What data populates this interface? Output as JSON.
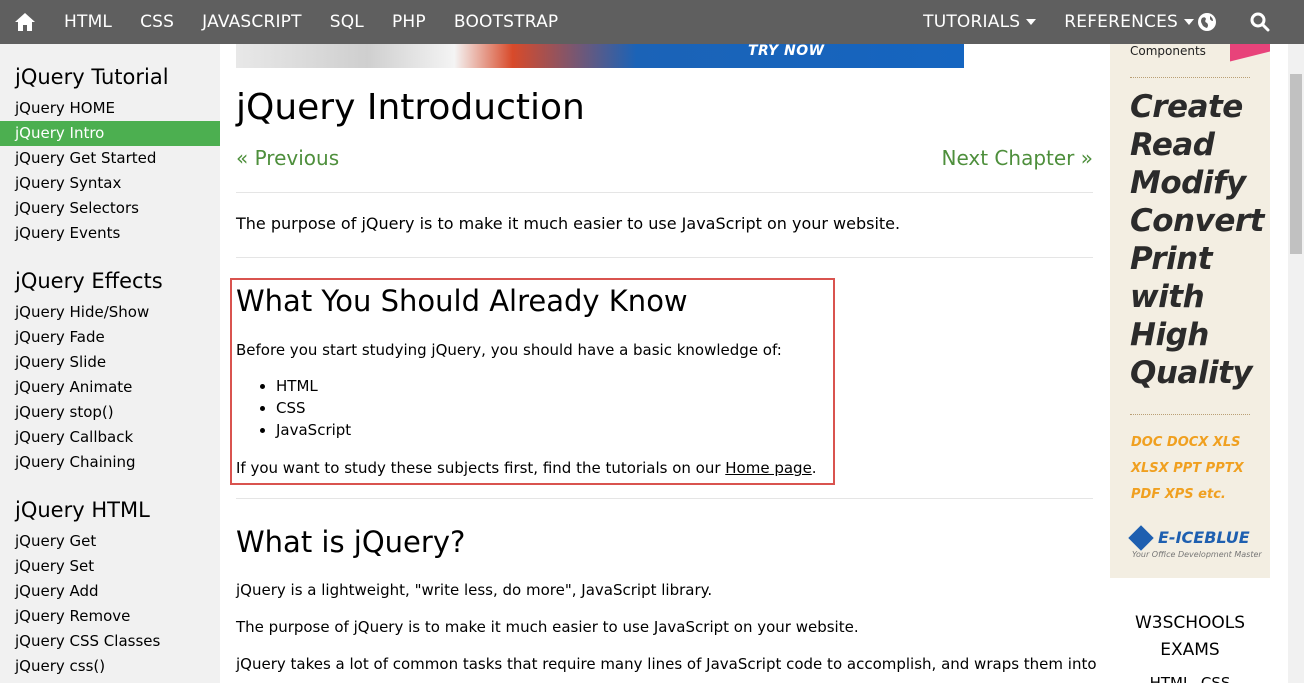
{
  "topnav": {
    "home_icon": "home-icon",
    "items": [
      "HTML",
      "CSS",
      "JAVASCRIPT",
      "SQL",
      "PHP",
      "BOOTSTRAP"
    ],
    "tutorials": "TUTORIALS",
    "references": "REFERENCES",
    "globe_icon": "globe-icon",
    "search_icon": "search-icon"
  },
  "sidebar": {
    "sections": [
      {
        "title": "jQuery Tutorial",
        "items": [
          "jQuery HOME",
          "jQuery Intro",
          "jQuery Get Started",
          "jQuery Syntax",
          "jQuery Selectors",
          "jQuery Events"
        ]
      },
      {
        "title": "jQuery Effects",
        "items": [
          "jQuery Hide/Show",
          "jQuery Fade",
          "jQuery Slide",
          "jQuery Animate",
          "jQuery stop()",
          "jQuery Callback",
          "jQuery Chaining"
        ]
      },
      {
        "title": "jQuery HTML",
        "items": [
          "jQuery Get",
          "jQuery Set",
          "jQuery Add",
          "jQuery Remove",
          "jQuery CSS Classes",
          "jQuery css()"
        ]
      }
    ],
    "active_item": "jQuery Intro"
  },
  "main": {
    "banner_text": "TRY NOW",
    "title": "jQuery Introduction",
    "prev": "« Previous",
    "next": "Next Chapter »",
    "intro": "The purpose of jQuery is to make it much easier to use JavaScript on your website.",
    "know_title": "What You Should Already Know",
    "know_lead": "Before you start studying jQuery, you should have a basic knowledge of:",
    "know_list": [
      "HTML",
      "CSS",
      "JavaScript"
    ],
    "know_footer_prefix": "If you want to study these subjects first, find the tutorials on our ",
    "know_footer_link": "Home page",
    "know_footer_suffix": ".",
    "whatis_title": "What is jQuery?",
    "whatis_p1": "jQuery is a lightweight, \"write less, do more\", JavaScript library.",
    "whatis_p2": "The purpose of jQuery is to make it much easier to use JavaScript on your website.",
    "whatis_p3": "jQuery takes a lot of common tasks that require many lines of JavaScript code to accomplish, and wraps them into"
  },
  "ad": {
    "components": "Components",
    "big_lines": [
      "Create",
      "Read",
      "Modify",
      "Convert",
      "Print",
      "with",
      "High",
      "Quality"
    ],
    "formats": [
      "DOC  DOCX  XLS",
      "XLSX  PPT  PPTX",
      "PDF  XPS  etc."
    ],
    "logo": "E-ICEBLUE",
    "tagline": "Your Office Development Master"
  },
  "right": {
    "exams": "W3SCHOOLS EXAMS",
    "exams_sub": "HTML, CSS"
  },
  "colors": {
    "topnav_bg": "#5f5f5f",
    "sidebar_bg": "#f1f1f1",
    "active_bg": "#4caf50",
    "link_green": "#4e8f3c",
    "highlight_border": "#d9534f"
  }
}
